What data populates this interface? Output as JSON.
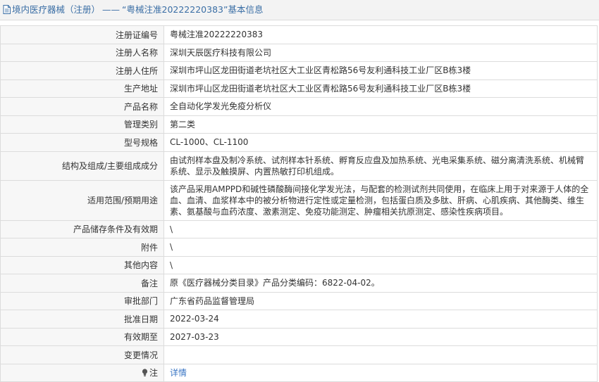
{
  "header": {
    "prefix": "境内医疗器械（注册）",
    "separator": "——",
    "title": "“粤械注准20222220383”基本信息"
  },
  "rows": [
    {
      "label": "注册证编号",
      "value": "粤械注准20222220383"
    },
    {
      "label": "注册人名称",
      "value": "深圳天辰医疗科技有限公司"
    },
    {
      "label": "注册人住所",
      "value": "深圳市坪山区龙田街道老坑社区大工业区青松路56号友利通科技工业厂区B栋3楼"
    },
    {
      "label": "生产地址",
      "value": "深圳市坪山区龙田街道老坑社区大工业区青松路56号友利通科技工业厂区B栋3楼"
    },
    {
      "label": "产品名称",
      "value": "全自动化学发光免疫分析仪"
    },
    {
      "label": "管理类别",
      "value": "第二类"
    },
    {
      "label": "型号规格",
      "value": "CL-1000、CL-1100"
    },
    {
      "label": "结构及组成/主要组成成分",
      "value": "由试剂样本盘及制冷系统、试剂样本针系统、孵育反应盘及加热系统、光电采集系统、磁分离清洗系统、机械臂系统、显示及触摸屏、内置热敏打印机组成。"
    },
    {
      "label": "适用范围/预期用途",
      "value": "该产品采用AMPPD和碱性磷酸酶间接化学发光法，与配套的检测试剂共同使用，在临床上用于对来源于人体的全血、血清、血浆样本中的被分析物进行定性或定量检测，包括蛋白质及多肽、肝病、心肌疾病、其他酶类、维生素、氨基酸与血药浓度、激素测定、免疫功能测定、肿瘤相关抗原测定、感染性疾病项目。"
    },
    {
      "label": "产品储存条件及有效期",
      "value": "\\"
    },
    {
      "label": "附件",
      "value": "\\"
    },
    {
      "label": "其他内容",
      "value": "\\"
    },
    {
      "label": "备注",
      "value": "原《医疗器械分类目录》产品分类编码：6822-04-02。"
    },
    {
      "label": "审批部门",
      "value": "广东省药品监督管理局"
    },
    {
      "label": "批准日期",
      "value": "2022-03-24"
    },
    {
      "label": "有效期至",
      "value": "2027-03-23"
    },
    {
      "label": "变更情况",
      "value": ""
    }
  ],
  "note": {
    "label": "注",
    "link_text": "详情"
  }
}
